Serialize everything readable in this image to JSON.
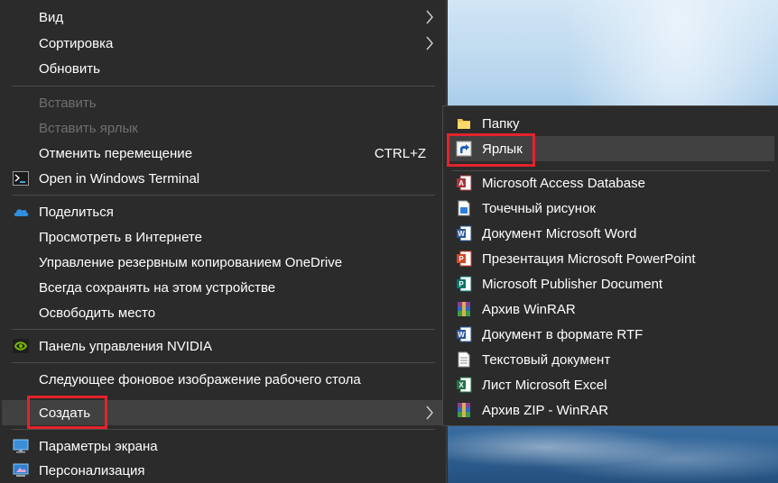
{
  "menu": {
    "items": [
      {
        "label": "Вид"
      },
      {
        "label": "Сортировка"
      },
      {
        "label": "Обновить"
      },
      {
        "label": "Вставить"
      },
      {
        "label": "Вставить ярлык"
      },
      {
        "label": "Отменить перемещение",
        "shortcut": "CTRL+Z"
      },
      {
        "label": "Open in Windows Terminal"
      },
      {
        "label": "Поделиться"
      },
      {
        "label": "Просмотреть в Интернете"
      },
      {
        "label": "Управление резервным копированием OneDrive"
      },
      {
        "label": "Всегда сохранять на этом устройстве"
      },
      {
        "label": "Освободить место"
      },
      {
        "label": "Панель управления NVIDIA"
      },
      {
        "label": "Следующее фоновое изображение рабочего стола"
      },
      {
        "label": "Создать"
      },
      {
        "label": "Параметры экрана"
      },
      {
        "label": "Персонализация"
      }
    ]
  },
  "submenu": {
    "items": [
      {
        "label": "Папку"
      },
      {
        "label": "Ярлык"
      },
      {
        "label": "Microsoft Access Database"
      },
      {
        "label": "Точечный рисунок"
      },
      {
        "label": "Документ Microsoft Word"
      },
      {
        "label": "Презентация Microsoft PowerPoint"
      },
      {
        "label": "Microsoft Publisher Document"
      },
      {
        "label": "Архив WinRAR"
      },
      {
        "label": "Документ в формате RTF"
      },
      {
        "label": "Текстовый документ"
      },
      {
        "label": "Лист Microsoft Excel"
      },
      {
        "label": "Архив ZIP - WinRAR"
      }
    ]
  },
  "icons": {
    "terminal": "terminal-icon",
    "onedrive": "onedrive-cloud-icon",
    "nvidia": "nvidia-icon",
    "display": "display-settings-icon",
    "personalize": "personalization-icon",
    "folder": "folder-icon",
    "shortcut": "shortcut-icon",
    "access": "access-icon",
    "bitmap": "bitmap-icon",
    "word": "word-icon",
    "powerpoint": "powerpoint-icon",
    "publisher": "publisher-icon",
    "winrar": "winrar-icon",
    "rtf": "rtf-icon",
    "text": "text-document-icon",
    "excel": "excel-icon"
  },
  "colors": {
    "menu_bg": "#2b2b2b",
    "hover_bg": "#414141",
    "disabled_text": "#6f6f6f",
    "highlight_box": "#e3232c"
  }
}
